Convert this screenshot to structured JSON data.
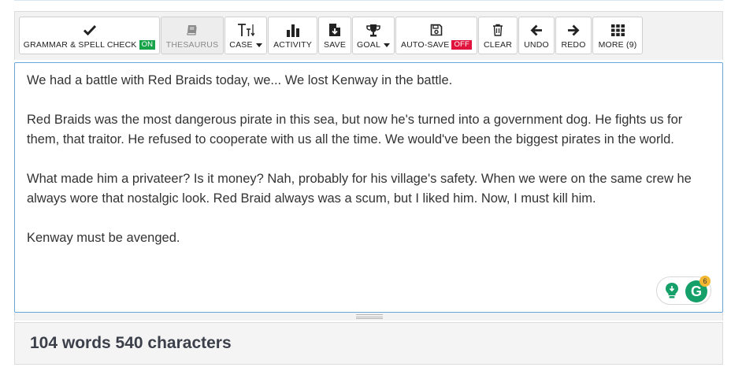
{
  "toolbar": {
    "buttons": [
      {
        "label": "GRAMMAR & SPELL CHECK",
        "badge": "ON",
        "icon": "check-icon"
      },
      {
        "label": "THESAURUS",
        "icon": "book-icon",
        "disabled": true
      },
      {
        "label": "CASE",
        "icon": "text-case-icon",
        "dropdown": true
      },
      {
        "label": "ACTIVITY",
        "icon": "bar-chart-icon"
      },
      {
        "label": "SAVE",
        "icon": "file-download-icon"
      },
      {
        "label": "GOAL",
        "icon": "trophy-icon",
        "dropdown": true
      },
      {
        "label": "AUTO-SAVE",
        "badge": "OFF",
        "icon": "floppy-disk-icon"
      },
      {
        "label": "CLEAR",
        "icon": "trash-icon"
      },
      {
        "label": "UNDO",
        "icon": "arrow-left-icon"
      },
      {
        "label": "REDO",
        "icon": "arrow-right-icon"
      },
      {
        "label": "MORE (9)",
        "icon": "grid-icon"
      }
    ]
  },
  "editor": {
    "paragraphs": [
      "We had a battle with Red Braids today, we... We lost Kenway in the battle.",
      "Red Braids was the most dangerous pirate in this sea, but now he's turned into a government dog. He fights us for them, that traitor. He refused to cooperate with us all the time. We would've been the biggest pirates in the world.",
      "What made him a privateer? Is it money? Nah, probably for his village's safety. When we were on the same crew he always wore that nostalgic look. Red Braid always was a scum, but I liked him. Now, I must kill him.",
      "Kenway must be avenged."
    ]
  },
  "assistant": {
    "g_letter": "G",
    "count": "6",
    "colors": {
      "green": "#15a06a",
      "badge": "#f4b731"
    }
  },
  "stats": {
    "text": "104 words 540 characters"
  },
  "colors": {
    "on_badge": "#17a34a",
    "off_badge": "#e0143c",
    "editor_border": "#6aa6d6"
  }
}
